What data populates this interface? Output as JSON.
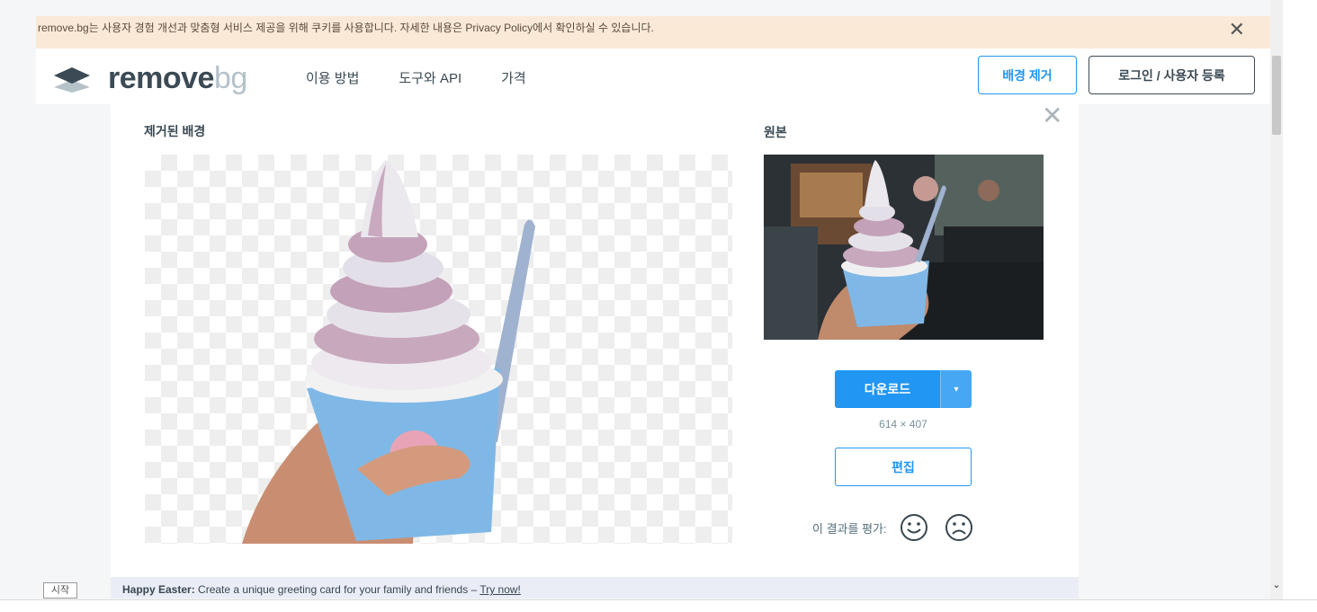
{
  "cookie_bar": {
    "text": "remove.bg는 사용자 경험 개선과 맞춤형 서비스 제공을 위해 쿠키를 사용합니다. 자세한 내용은 Privacy Policy에서 확인하실 수 있습니다.",
    "close_glyph": "✕"
  },
  "header": {
    "logo_part1": "remove",
    "logo_part2": "bg",
    "nav": [
      "이용 방법",
      "도구와 API",
      "가격"
    ],
    "remove_bg_button": "배경 제거",
    "login_button": "로그인 / 사용자 등록"
  },
  "result": {
    "close_glyph": "✕",
    "removed_label": "제거된 배경",
    "original_label": "원본",
    "download_button": "다운로드",
    "caret": "▾",
    "dimensions": "614 × 407",
    "edit_button": "편집",
    "rate_label": "이 결과를 평가:"
  },
  "banner": {
    "bold": "Happy Easter:",
    "text": " Create a unique greeting card for your family and friends – ",
    "link": "Try now!"
  },
  "start_badge": "시작",
  "scroll_down_glyph": "⌄",
  "colors": {
    "accent": "#2196f3",
    "logo_dark": "#3b4a54",
    "logo_light": "#b6c2ca",
    "cookie_bg": "#fbe9d8",
    "banner_bg": "#ebedf6"
  }
}
